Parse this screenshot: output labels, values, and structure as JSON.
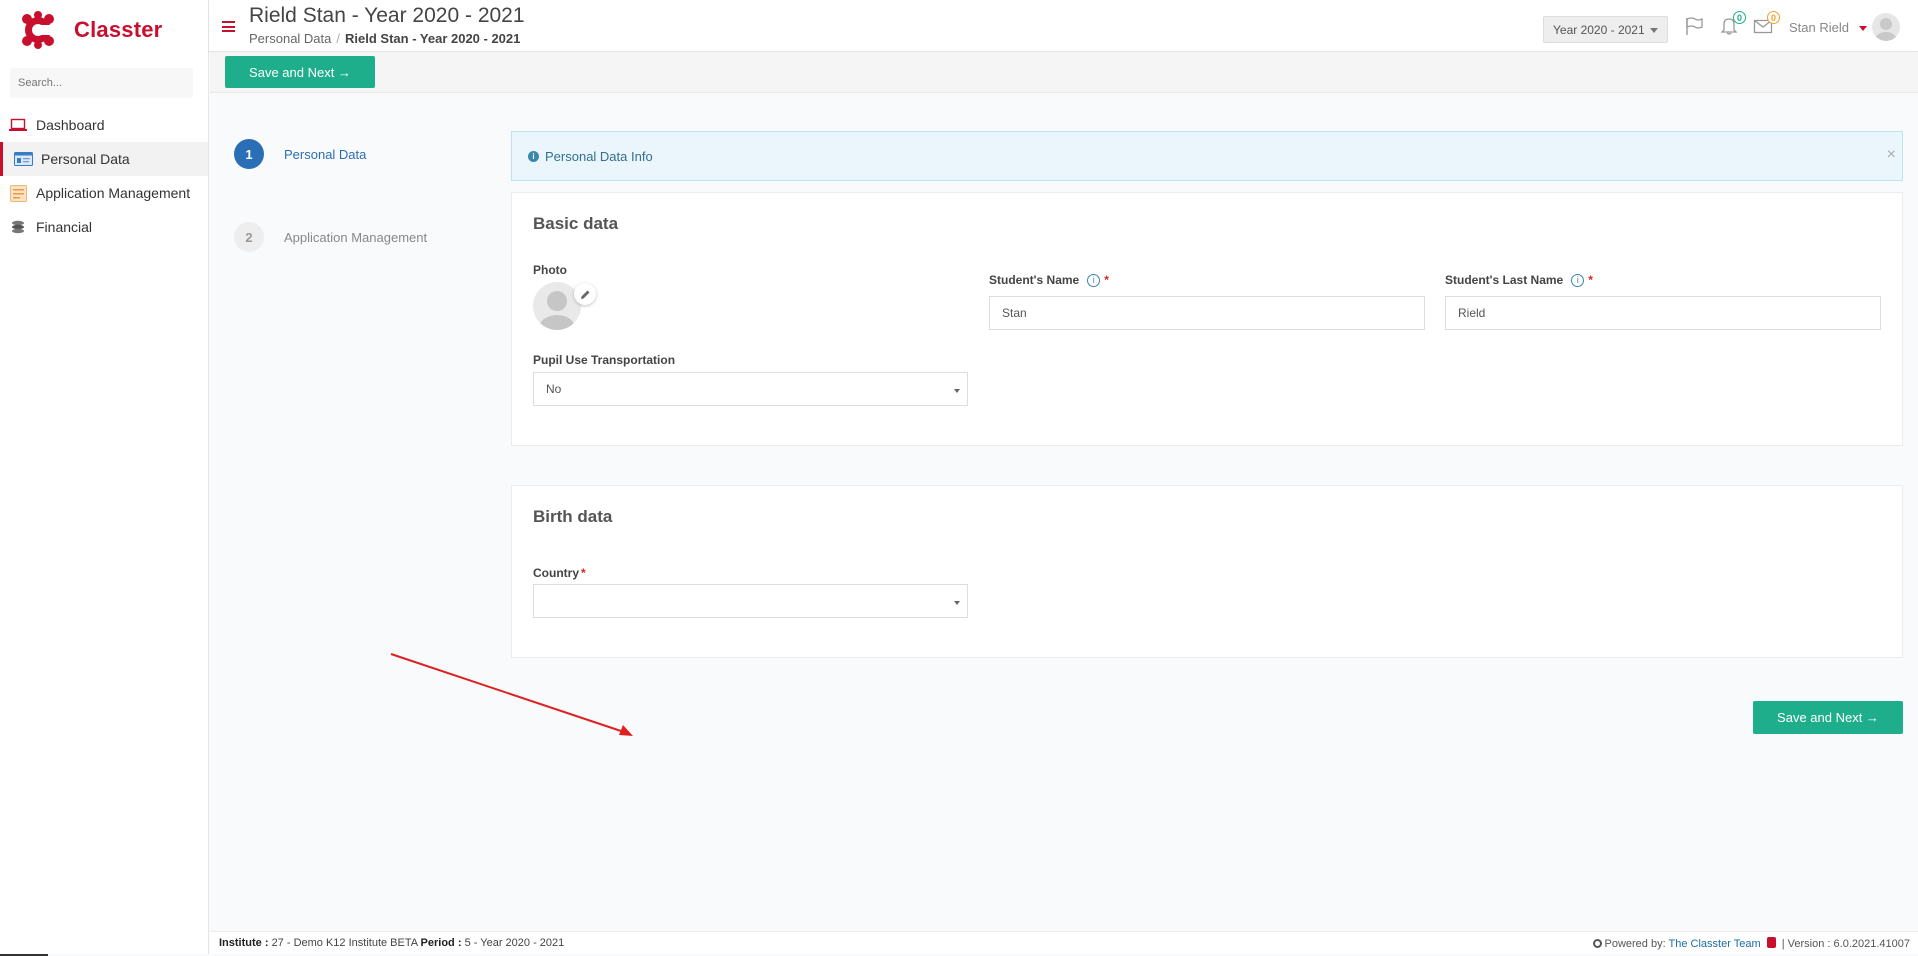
{
  "app": {
    "name": "Classter"
  },
  "sidebar": {
    "search_placeholder": "Search...",
    "items": [
      {
        "label": "Dashboard",
        "icon": "laptop-icon",
        "active": false
      },
      {
        "label": "Personal Data",
        "icon": "id-card-icon",
        "active": true
      },
      {
        "label": "Application Management",
        "icon": "form-icon",
        "active": false
      },
      {
        "label": "Financial",
        "icon": "coins-icon",
        "active": false
      }
    ]
  },
  "header": {
    "title": "Rield Stan - Year 2020 - 2021",
    "breadcrumb": [
      "Personal Data",
      "Rield Stan - Year 2020 - 2021"
    ],
    "breadcrumb_separator": "/",
    "year_select": "Year 2020 - 2021",
    "notifications_count": "0",
    "messages_count": "0",
    "user_name": "Stan Rield"
  },
  "toolbar": {
    "save_next_label": "Save and Next →"
  },
  "steps": [
    {
      "number": "1",
      "label": "Personal Data",
      "active": true
    },
    {
      "number": "2",
      "label": "Application Management",
      "active": false
    }
  ],
  "alert": {
    "text": "Personal Data Info",
    "close": "×"
  },
  "basic_data": {
    "title": "Basic data",
    "photo_label": "Photo",
    "student_name_label": "Student's Name",
    "student_name_value": "Stan",
    "student_last_name_label": "Student's Last Name",
    "student_last_name_value": "Rield",
    "transport_label": "Pupil Use Transportation",
    "transport_value": "No",
    "required_mark": "*",
    "info_mark": "i"
  },
  "birth_data": {
    "title": "Birth data",
    "country_label": "Country",
    "country_value": "",
    "required_mark": "*"
  },
  "bottom": {
    "save_next_label": "Save and Next →"
  },
  "footer": {
    "institute_label": "Institute :",
    "institute_value": "27 - Demo K12 Institute BETA",
    "period_label": "Period :",
    "period_value": "5 - Year 2020 - 2021",
    "powered_by": "Powered by:",
    "team_link": "The Classter Team",
    "version": "| Version : 6.0.2021.41007"
  },
  "colors": {
    "brand": "#c8102e",
    "accent_green": "#1fae8c",
    "step_active": "#2a6fb5",
    "info_blue": "#3a87ad",
    "annotation_arrow": "#e02020"
  }
}
